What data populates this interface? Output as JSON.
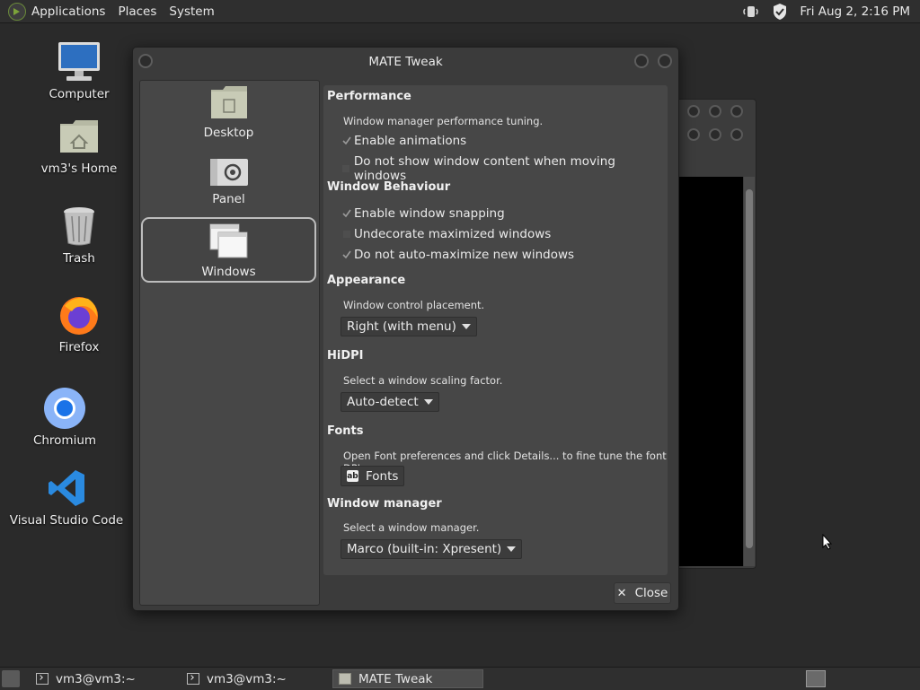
{
  "top_panel": {
    "menus": [
      "Applications",
      "Places",
      "System"
    ],
    "clock": "Fri Aug  2,  2:16 PM",
    "tray_icons": [
      "volume-icon",
      "shield-icon"
    ]
  },
  "desktop": {
    "icons": [
      {
        "label": "Computer",
        "icon": "computer-icon"
      },
      {
        "label": "vm3's Home",
        "icon": "home-folder-icon"
      },
      {
        "label": "Trash",
        "icon": "trash-icon"
      },
      {
        "label": "Firefox",
        "icon": "firefox-icon"
      },
      {
        "label": "Chromium",
        "icon": "chromium-icon"
      },
      {
        "label": "Visual Studio Code",
        "icon": "vscode-icon"
      }
    ]
  },
  "dialog": {
    "title": "MATE Tweak",
    "sidebar": [
      {
        "label": "Desktop",
        "selected": false
      },
      {
        "label": "Panel",
        "selected": false
      },
      {
        "label": "Windows",
        "selected": true
      }
    ],
    "sections": {
      "performance": {
        "title": "Performance",
        "desc": "Window manager performance tuning.",
        "options": [
          {
            "label": "Enable animations",
            "checked": true
          },
          {
            "label": "Do not show window content when moving windows",
            "checked": false
          }
        ]
      },
      "behaviour": {
        "title": "Window Behaviour",
        "options": [
          {
            "label": "Enable window snapping",
            "checked": true
          },
          {
            "label": "Undecorate maximized windows",
            "checked": false
          },
          {
            "label": "Do not auto-maximize new windows",
            "checked": true
          }
        ]
      },
      "appearance": {
        "title": "Appearance",
        "desc": "Window control placement.",
        "value": "Right (with menu)"
      },
      "hidpi": {
        "title": "HiDPI",
        "desc": "Select a window scaling factor.",
        "value": "Auto-detect"
      },
      "fonts": {
        "title": "Fonts",
        "desc": "Open Font preferences and click Details... to fine tune the font DPI.",
        "button": "Fonts"
      },
      "wm": {
        "title": "Window manager",
        "desc": "Select a window manager.",
        "value": "Marco (built-in: Xpresent)"
      }
    },
    "close_label": "Close"
  },
  "taskbar": {
    "tasks": [
      {
        "label": "vm3@vm3:~",
        "active": false
      },
      {
        "label": "vm3@vm3:~",
        "active": false
      },
      {
        "label": "MATE Tweak",
        "active": true
      }
    ]
  },
  "colors": {
    "panel": "#2f2f2f",
    "desktop": "#2a2a2a",
    "dialog": "#3b3b3b",
    "pane": "#474747"
  }
}
